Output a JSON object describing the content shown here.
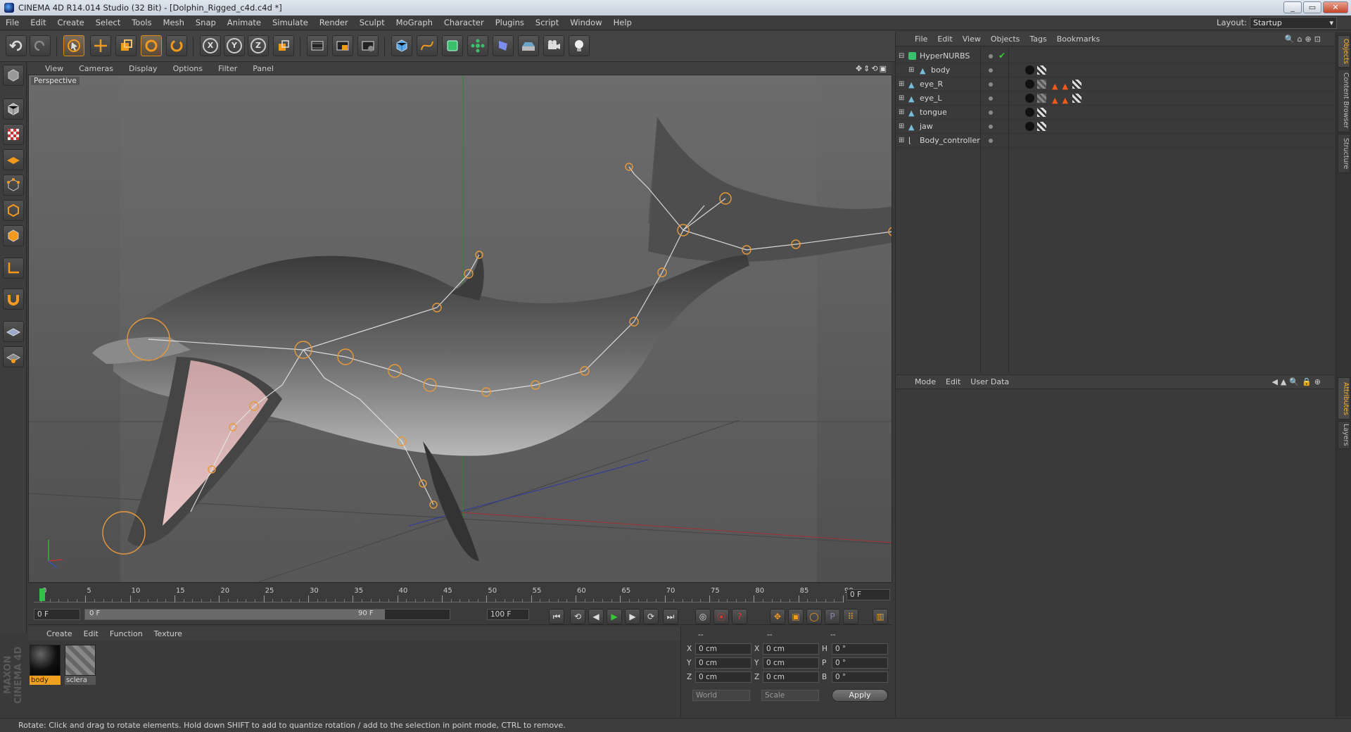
{
  "window": {
    "title": "CINEMA 4D R14.014 Studio (32 Bit) - [Dolphin_Rigged_c4d.c4d *]",
    "buttons": [
      "_",
      "▭",
      "✕"
    ]
  },
  "menubar": {
    "items": [
      "File",
      "Edit",
      "Create",
      "Select",
      "Tools",
      "Mesh",
      "Snap",
      "Animate",
      "Simulate",
      "Render",
      "Sculpt",
      "MoGraph",
      "Character",
      "Plugins",
      "Script",
      "Window",
      "Help"
    ],
    "layout_label": "Layout:",
    "layout_value": "Startup"
  },
  "toolbar": {
    "icons": [
      "undo-icon",
      "redo-icon",
      "live-selection-icon",
      "move-icon",
      "scale-icon",
      "rotate-icon",
      "recent-tool-icon",
      "x-axis-icon",
      "y-axis-icon",
      "z-axis-icon",
      "coordinate-system-icon",
      "render-view-icon",
      "render-picture-viewer-icon",
      "edit-render-settings-icon",
      "cube-icon",
      "spline-pen-icon",
      "subdivision-surface-icon",
      "array-icon",
      "deformer-icon",
      "floor-icon",
      "camera-icon",
      "light-icon"
    ],
    "axis_x": "X",
    "axis_y": "Y",
    "axis_z": "Z"
  },
  "viewport": {
    "menu": [
      "View",
      "Cameras",
      "Display",
      "Options",
      "Filter",
      "Panel"
    ],
    "label": "Perspective"
  },
  "timeline": {
    "ticks": [
      "0",
      "5",
      "10",
      "15",
      "20",
      "25",
      "30",
      "35",
      "40",
      "45",
      "50",
      "55",
      "60",
      "65",
      "70",
      "75",
      "80",
      "85",
      "90"
    ],
    "current_frame": "0 F"
  },
  "transport": {
    "start": "0 F",
    "range_start": "0 F",
    "range_end": "90 F",
    "end": "100 F"
  },
  "materials": {
    "menu": [
      "Create",
      "Edit",
      "Function",
      "Texture"
    ],
    "items": [
      {
        "name": "body",
        "selected": true
      },
      {
        "name": "sclera",
        "selected": false
      }
    ]
  },
  "coordinates": {
    "header_a": "--",
    "header_b": "--",
    "header_c": "--",
    "pos": [
      {
        "axis": "X",
        "value": "0 cm"
      },
      {
        "axis": "Y",
        "value": "0 cm"
      },
      {
        "axis": "Z",
        "value": "0 cm"
      }
    ],
    "size": [
      {
        "axis": "X",
        "value": "0 cm"
      },
      {
        "axis": "Y",
        "value": "0 cm"
      },
      {
        "axis": "Z",
        "value": "0 cm"
      }
    ],
    "rot": [
      {
        "axis": "H",
        "value": "0 °"
      },
      {
        "axis": "P",
        "value": "0 °"
      },
      {
        "axis": "B",
        "value": "0 °"
      }
    ],
    "mode_world": "World",
    "mode_scale": "Scale",
    "apply": "Apply"
  },
  "object_manager": {
    "menu": [
      "File",
      "Edit",
      "View",
      "Objects",
      "Tags",
      "Bookmarks"
    ],
    "objects": [
      {
        "name": "HyperNURBS",
        "level": 0
      },
      {
        "name": "body",
        "level": 1
      },
      {
        "name": "eye_R",
        "level": 0
      },
      {
        "name": "eye_L",
        "level": 0
      },
      {
        "name": "tongue",
        "level": 0
      },
      {
        "name": "jaw",
        "level": 0
      },
      {
        "name": "Body_controller",
        "level": 0
      }
    ]
  },
  "attribute_manager": {
    "menu": [
      "Mode",
      "Edit",
      "User Data"
    ]
  },
  "right_tabs": {
    "top": [
      "Objects",
      "Content Browser",
      "Structure"
    ],
    "bottom": [
      "Attributes",
      "Layers"
    ]
  },
  "branding": "MAXON CINEMA 4D",
  "status": "Rotate: Click and drag to rotate elements. Hold down SHIFT to add to quantize rotation / add to the selection in point mode, CTRL to remove.",
  "colors": {
    "accent": "#d98a1c",
    "panel": "#3a3a3a",
    "viewport": "#5f5f5f"
  }
}
